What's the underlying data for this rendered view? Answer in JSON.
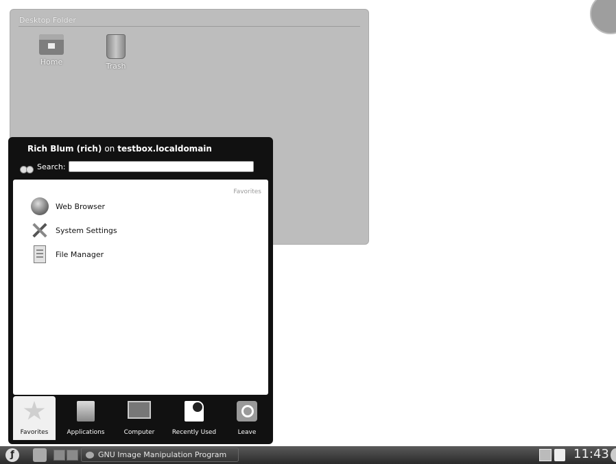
{
  "desktop_folder": {
    "title": "Desktop Folder",
    "icons": [
      {
        "label": "Home",
        "icon": "home-folder-icon"
      },
      {
        "label": "Trash",
        "icon": "trash-icon"
      }
    ]
  },
  "kickoff": {
    "user_name": "Rich Blum (rich)",
    "user_on": "on",
    "host": "testbox.localdomain",
    "search_label": "Search:",
    "search_value": "",
    "section_header": "Favorites",
    "favorites": [
      {
        "label": "Web Browser",
        "icon": "globe-icon"
      },
      {
        "label": "System Settings",
        "icon": "tools-icon"
      },
      {
        "label": "File Manager",
        "icon": "file-manager-icon"
      }
    ],
    "tabs": [
      {
        "label": "Favorites",
        "icon": "star-icon",
        "active": true
      },
      {
        "label": "Applications",
        "icon": "applications-icon"
      },
      {
        "label": "Computer",
        "icon": "computer-icon"
      },
      {
        "label": "Recently Used",
        "icon": "recently-used-icon"
      },
      {
        "label": "Leave",
        "icon": "power-icon"
      }
    ]
  },
  "taskbar": {
    "kde_button": "ƒ",
    "task_label": "GNU Image Manipulation Program",
    "clock": "11:43"
  }
}
